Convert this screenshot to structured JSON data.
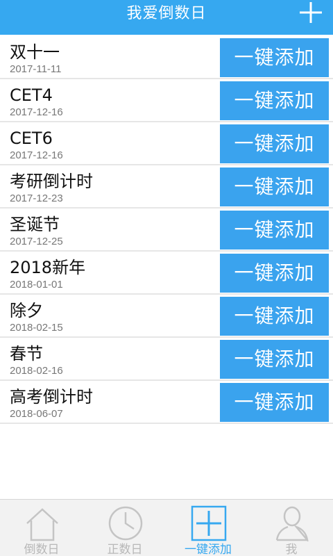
{
  "header": {
    "title": "我爱倒数日",
    "add_icon": "plus-icon"
  },
  "items": [
    {
      "name": "双十一",
      "date": "2017-11-11",
      "button": "一键添加"
    },
    {
      "name": "CET4",
      "date": "2017-12-16",
      "button": "一键添加"
    },
    {
      "name": "CET6",
      "date": "2017-12-16",
      "button": "一键添加"
    },
    {
      "name": "考研倒计时",
      "date": "2017-12-23",
      "button": "一键添加"
    },
    {
      "name": "圣诞节",
      "date": "2017-12-25",
      "button": "一键添加"
    },
    {
      "name": "2018新年",
      "date": "2018-01-01",
      "button": "一键添加"
    },
    {
      "name": "除夕",
      "date": "2018-02-15",
      "button": "一键添加"
    },
    {
      "name": "春节",
      "date": "2018-02-16",
      "button": "一键添加"
    },
    {
      "name": "高考倒计时",
      "date": "2018-06-07",
      "button": "一键添加"
    }
  ],
  "tabs": [
    {
      "label": "倒数日",
      "icon": "house-icon",
      "active": false
    },
    {
      "label": "正数日",
      "icon": "clock-icon",
      "active": false
    },
    {
      "label": "一键添加",
      "icon": "plus-box-icon",
      "active": true
    },
    {
      "label": "我",
      "icon": "person-icon",
      "active": false
    }
  ],
  "colors": {
    "primary": "#36a8f0",
    "button": "#3aa3ee",
    "tab_inactive": "#b8b8b8"
  }
}
